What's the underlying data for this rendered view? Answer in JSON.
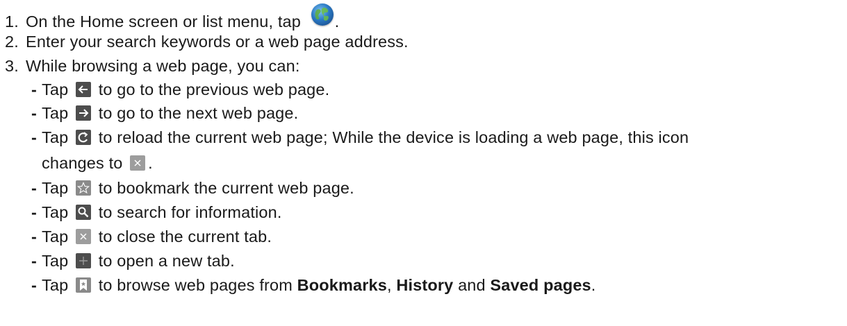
{
  "steps": [
    {
      "num": "1.",
      "before": "On the Home screen or list menu, tap",
      "after": "."
    },
    {
      "num": "2.",
      "text": "Enter your search keywords or a web page address."
    },
    {
      "num": "3.",
      "text": "While browsing a web page, you can:"
    }
  ],
  "bullets": {
    "dash": "-",
    "tap": "Tap",
    "back": "to go to the previous web page.",
    "forward": "to go to the next web page.",
    "reload_line1": "to reload the current web page; While the device is loading a web page, this icon",
    "reload_line2": "changes to",
    "reload_end": ".",
    "bookmark": "to bookmark the current web page.",
    "search": "to search for information.",
    "close": "to close the current tab.",
    "newtab": "to open a new tab.",
    "browse_pre": "to browse web pages from",
    "bookmarks": "Bookmarks",
    "comma": ",",
    "history": "History",
    "and": "and",
    "saved": "Saved pages",
    "period": "."
  },
  "icons": {
    "browser": "globe-icon",
    "back": "arrow-left-icon",
    "forward": "arrow-right-icon",
    "reload": "refresh-icon",
    "stop": "close-icon",
    "bookmark": "star-icon",
    "search": "search-icon",
    "close_tab": "close-icon",
    "new_tab": "plus-icon",
    "bookmarks_list": "bookmark-icon"
  },
  "colors": {
    "text": "#1a1a1a",
    "icon_dark": "#4d4d4d",
    "icon_light": "#9d9d9d",
    "globe": "#2a79c4"
  }
}
